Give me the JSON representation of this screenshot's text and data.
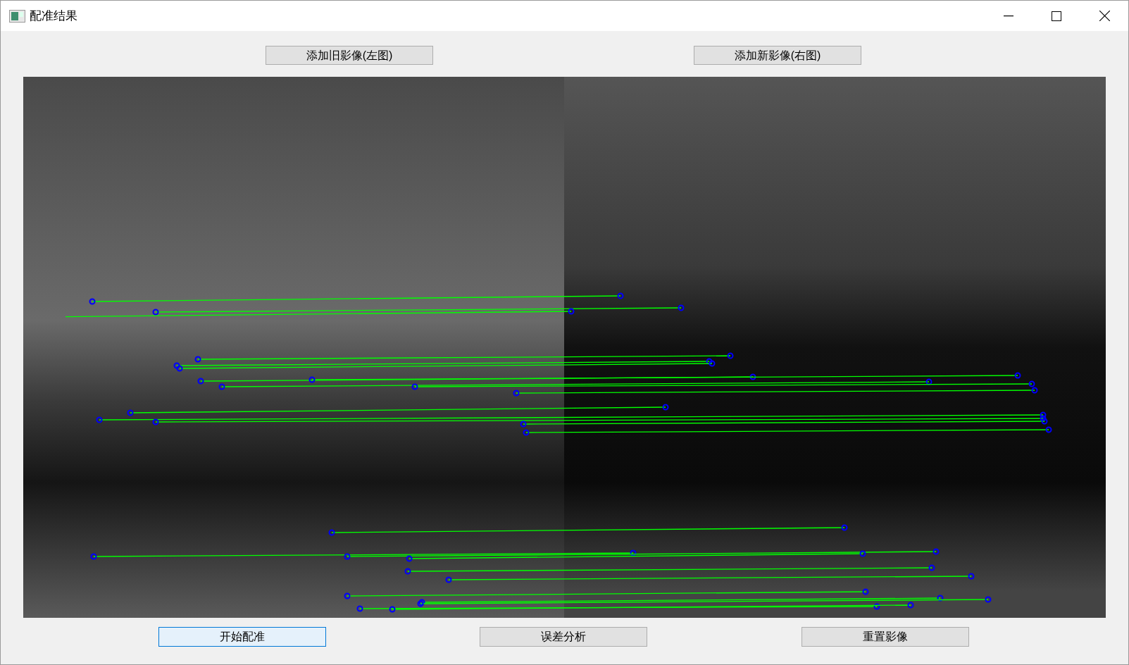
{
  "window": {
    "title": "配准结果"
  },
  "top_buttons": [
    {
      "label": "添加旧影像(左图)"
    },
    {
      "label": "添加新影像(右图)"
    }
  ],
  "bottom_buttons": [
    {
      "label": "开始配准",
      "focused": true
    },
    {
      "label": "误差分析",
      "focused": false
    },
    {
      "label": "重置影像",
      "focused": false
    }
  ]
}
